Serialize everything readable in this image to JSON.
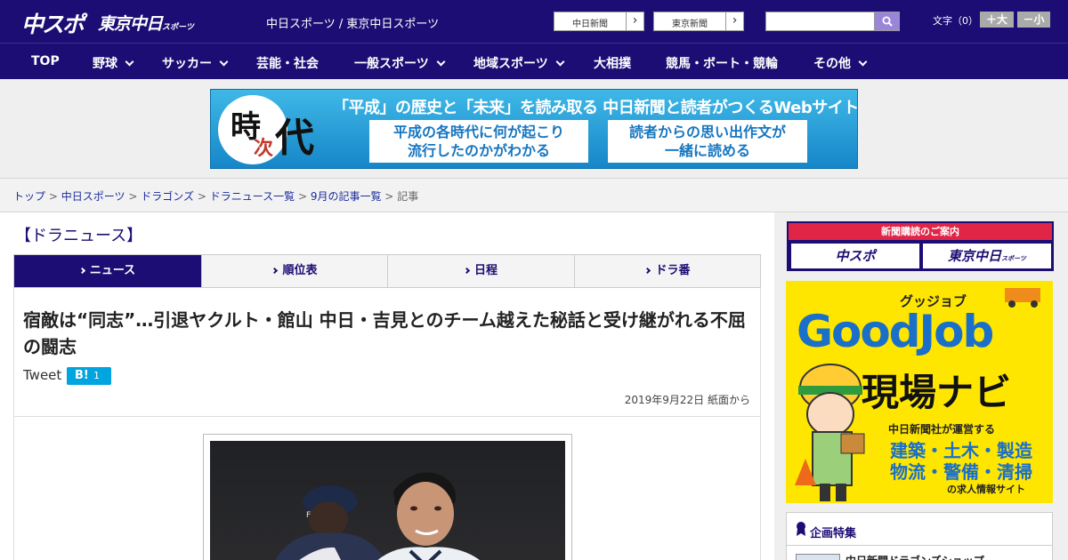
{
  "header": {
    "logo_chuspo": "中スポ",
    "logo_tokyo": "東京中日",
    "logo_tokyo_small": "スポーツ",
    "site_link": "中日スポーツ / 東京中日スポーツ",
    "paper_buttons": [
      "中日新聞",
      "東京新聞"
    ],
    "font_label": "文字（0）",
    "font_bigger": "＋大",
    "font_smaller": "－小",
    "brand_color": "#1c0d74"
  },
  "nav": {
    "items": [
      {
        "label": "TOP",
        "has_menu": false
      },
      {
        "label": "野球",
        "has_menu": true
      },
      {
        "label": "サッカー",
        "has_menu": true
      },
      {
        "label": "芸能・社会",
        "has_menu": false
      },
      {
        "label": "一般スポーツ",
        "has_menu": true
      },
      {
        "label": "地域スポーツ",
        "has_menu": true
      },
      {
        "label": "大相撲",
        "has_menu": false
      },
      {
        "label": "競馬・ボート・競輪",
        "has_menu": false
      },
      {
        "label": "その他",
        "has_menu": true
      }
    ]
  },
  "banner": {
    "char1": "時",
    "char2": "次",
    "char3": "代",
    "headline": "「平成」の歴史と「未来」を読み取る 中日新聞と読者がつくるWebサイト",
    "box1_line1": "平成の各時代に何が起こり",
    "box1_line2": "流行したのかがわかる",
    "box2_line1": "読者からの思い出作文が",
    "box2_line2": "一緒に読める"
  },
  "breadcrumb": {
    "links": [
      "トップ",
      "中日スポーツ",
      "ドラゴンズ",
      "ドラニュース一覧",
      "9月の記事一覧"
    ],
    "current": "記事",
    "separator": ">"
  },
  "section_title": "【ドラニュース】",
  "tabs": [
    {
      "label": "ニュース",
      "active": true
    },
    {
      "label": "順位表",
      "active": false
    },
    {
      "label": "日程",
      "active": false
    },
    {
      "label": "ドラ番",
      "active": false
    }
  ],
  "article": {
    "headline": "宿敵は“同志”…引退ヤクルト・館山 中日・吉見とのチーム越えた秘話と受け継がれる不屈の闘志",
    "tweet_label": "Tweet",
    "hatena_label": "B!",
    "hatena_count": "1",
    "date": "2019年9月22日 紙面から"
  },
  "sidebar": {
    "subscribe_head": "新聞購読のご案内",
    "subscribe_buttons": [
      "中スポ",
      "東京中日"
    ],
    "subscribe_small": "スポーツ",
    "ad": {
      "kana": "グッジョブ",
      "title": "GoodJob",
      "subtitle": "現場ナビ",
      "line1": "中日新聞社が運営する",
      "line2": "建築・土木・製造",
      "line3": "物流・警備・清掃",
      "line4": "の求人情報サイト"
    },
    "feature_title": "企画特集",
    "feature_item": "中日新聞ドラゴンズショップ"
  }
}
